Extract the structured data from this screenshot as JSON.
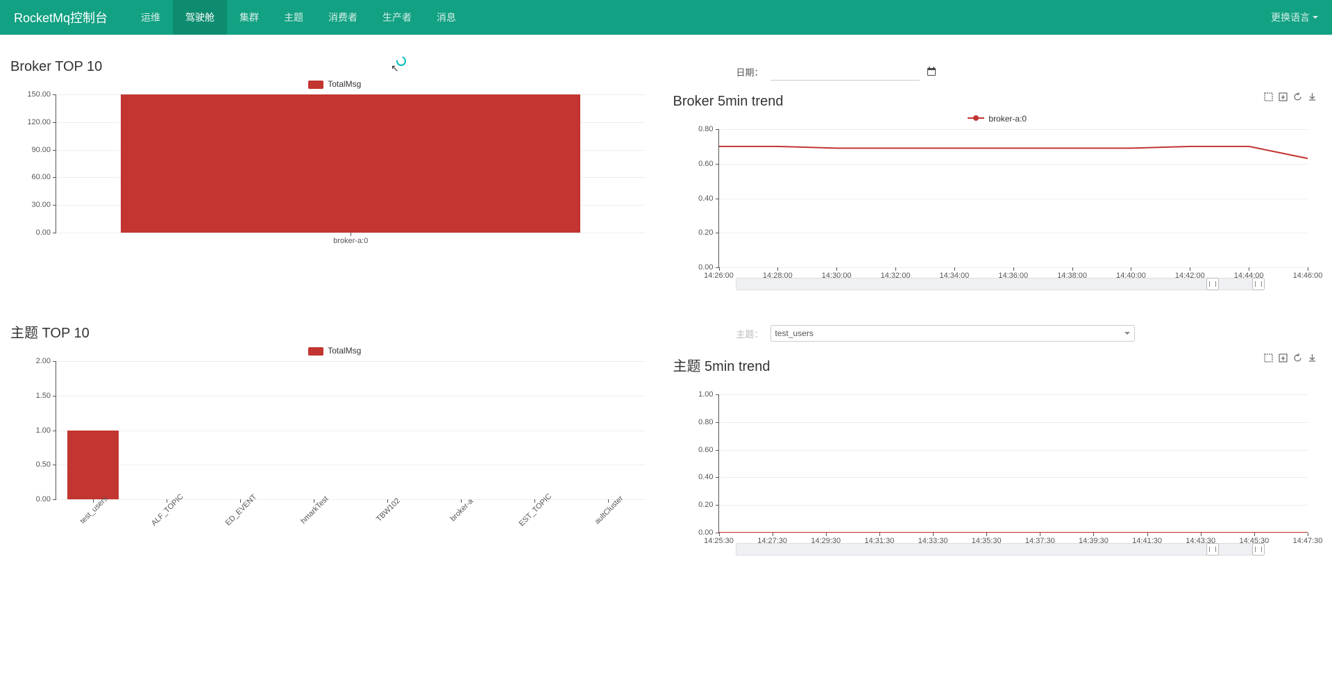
{
  "nav": {
    "brand": "RocketMq控制台",
    "items": [
      "运维",
      "驾驶舱",
      "集群",
      "主题",
      "消费者",
      "生产者",
      "消息"
    ],
    "active_index": 1,
    "lang_switch": "更换语言"
  },
  "date_picker": {
    "label": "日期：",
    "value": ""
  },
  "topic_picker": {
    "label": "主题：",
    "value": "test_users"
  },
  "chart_data": [
    {
      "id": "broker_top10",
      "type": "bar",
      "title": "Broker TOP 10",
      "legend": "TotalMsg",
      "categories": [
        "broker-a:0"
      ],
      "values": [
        150
      ],
      "ylim": [
        0,
        150
      ],
      "yticks": [
        0,
        30,
        60,
        90,
        120,
        150
      ],
      "ytick_fmt": "fixed2"
    },
    {
      "id": "topic_top10",
      "type": "bar",
      "title": "主题 TOP 10",
      "legend": "TotalMsg",
      "categories": [
        "test_users",
        "ALF_TOPIC",
        "ED_EVENT",
        "hmarkTest",
        "TBW102",
        "broker-a",
        "EST_TOPIC",
        "aultCluster"
      ],
      "values": [
        1,
        0,
        0,
        0,
        0,
        0,
        0,
        0
      ],
      "ylim": [
        0,
        2
      ],
      "yticks": [
        0,
        0.5,
        1.0,
        1.5,
        2.0
      ],
      "ytick_fmt": "fixed2",
      "xlabel_rotate": true
    },
    {
      "id": "broker_5min",
      "type": "line",
      "title": "Broker 5min trend",
      "series_name": "broker-a:0",
      "x": [
        "14:26:00",
        "14:28:00",
        "14:30:00",
        "14:32:00",
        "14:34:00",
        "14:36:00",
        "14:38:00",
        "14:40:00",
        "14:42:00",
        "14:44:00",
        "14:46:00"
      ],
      "values": [
        0.7,
        0.7,
        0.69,
        0.69,
        0.69,
        0.69,
        0.69,
        0.69,
        0.7,
        0.7,
        0.63
      ],
      "ylim": [
        0,
        0.8
      ],
      "yticks": [
        0,
        0.2,
        0.4,
        0.6,
        0.8
      ],
      "ytick_fmt": "fixed2",
      "has_zoom": true
    },
    {
      "id": "topic_5min",
      "type": "line",
      "title": "主题 5min trend",
      "series_name": "",
      "x": [
        "14:25:30",
        "14:27:30",
        "14:29:30",
        "14:31:30",
        "14:33:30",
        "14:35:30",
        "14:37:30",
        "14:39:30",
        "14:41:30",
        "14:43:30",
        "14:45:30",
        "14:47:30"
      ],
      "values": [
        0,
        0,
        0,
        0,
        0,
        0,
        0,
        0,
        0,
        0,
        0,
        0
      ],
      "ylim": [
        0,
        1
      ],
      "yticks": [
        0,
        0.2,
        0.4,
        0.6,
        0.8,
        1.0
      ],
      "ytick_fmt": "fixed2",
      "has_zoom": true
    }
  ]
}
